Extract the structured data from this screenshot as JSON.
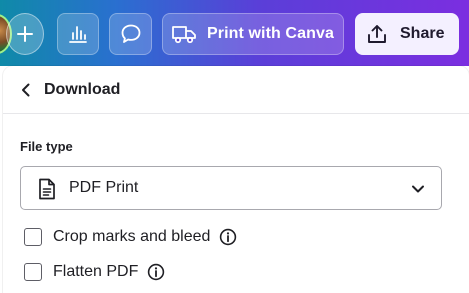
{
  "toolbar": {
    "print_label": "Print with Canva",
    "share_label": "Share",
    "icons": {
      "plus": "plus-icon",
      "insights": "bar-chart-icon",
      "comment": "comment-icon",
      "print": "truck-icon",
      "share": "upload-icon"
    }
  },
  "panel": {
    "title": "Download",
    "file_type_label": "File type",
    "file_type_value": "PDF Print",
    "options": [
      {
        "label": "Crop marks and bleed",
        "checked": false
      },
      {
        "label": "Flatten PDF",
        "checked": false
      }
    ]
  },
  "colors": {
    "gradient_start": "#0f8aa8",
    "gradient_end": "#7b2ee0",
    "share_bg": "#f4f0ff",
    "text": "#1f1f24"
  }
}
